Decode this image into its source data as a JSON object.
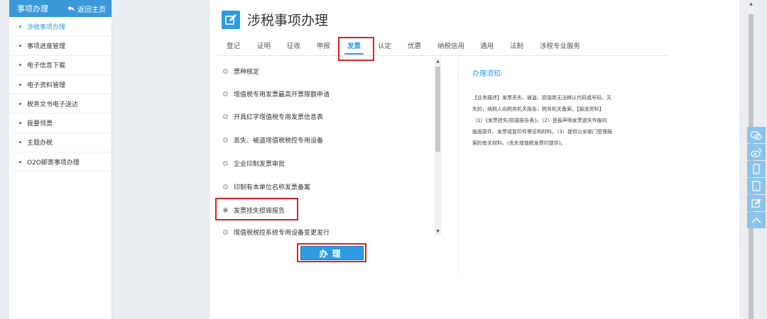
{
  "sidebar": {
    "header_title": "事项办理",
    "back_label": "返回主页",
    "items": [
      {
        "label": "涉税事项办理",
        "active": true
      },
      {
        "label": "事项进度管理"
      },
      {
        "label": "电子信息下载"
      },
      {
        "label": "电子资料管理"
      },
      {
        "label": "税务文书电子送达"
      },
      {
        "label": "我要领票"
      },
      {
        "label": "主题办税"
      },
      {
        "label": "O2O邮寄事项办理"
      }
    ]
  },
  "main": {
    "title": "涉税事项办理",
    "tabs": [
      "登记",
      "证明",
      "征收",
      "申报",
      "发票",
      "认定",
      "优惠",
      "纳税信用",
      "通用",
      "法制",
      "涉税专业服务"
    ],
    "active_tab": "发票",
    "options": [
      "票种核定",
      "增值税专用发票最高开票限额申请",
      "开具红字增值税专用发票信息表",
      "丢失、被盗增值税税控专用设备",
      "企业印制发票审批",
      "印制有本单位名称发票备案",
      "发票挂失损毁报告",
      "增值税税控系统专用设备变更发行"
    ],
    "selected_option": "发票挂失损毁报告",
    "submit_label": "办理"
  },
  "notice": {
    "title": "办理须知:",
    "lines": [
      "【业务描述】发票丢失、被盗、损毁致无法辨认代码或号码、灭",
      "失的，纳税人向税务机关报告，税务机关备案。【报送资料】",
      "（1）《发票挂失/损毁报告表》。（2）登报声明发票遗失作废的",
      "版面原件、发票或复印件等证明材料。（3）提供公安部门受理报",
      "案的有关材料。(丢失增值税发票时提供)。"
    ]
  },
  "float_buttons": [
    "wechat-icon",
    "weibo-icon",
    "mobile-icon",
    "tablet-icon",
    "edit-icon",
    "back-to-top-icon"
  ],
  "colors": {
    "accent": "#2f9be3",
    "sidebar_header": "#3a98d8",
    "highlight": "#e02020"
  }
}
